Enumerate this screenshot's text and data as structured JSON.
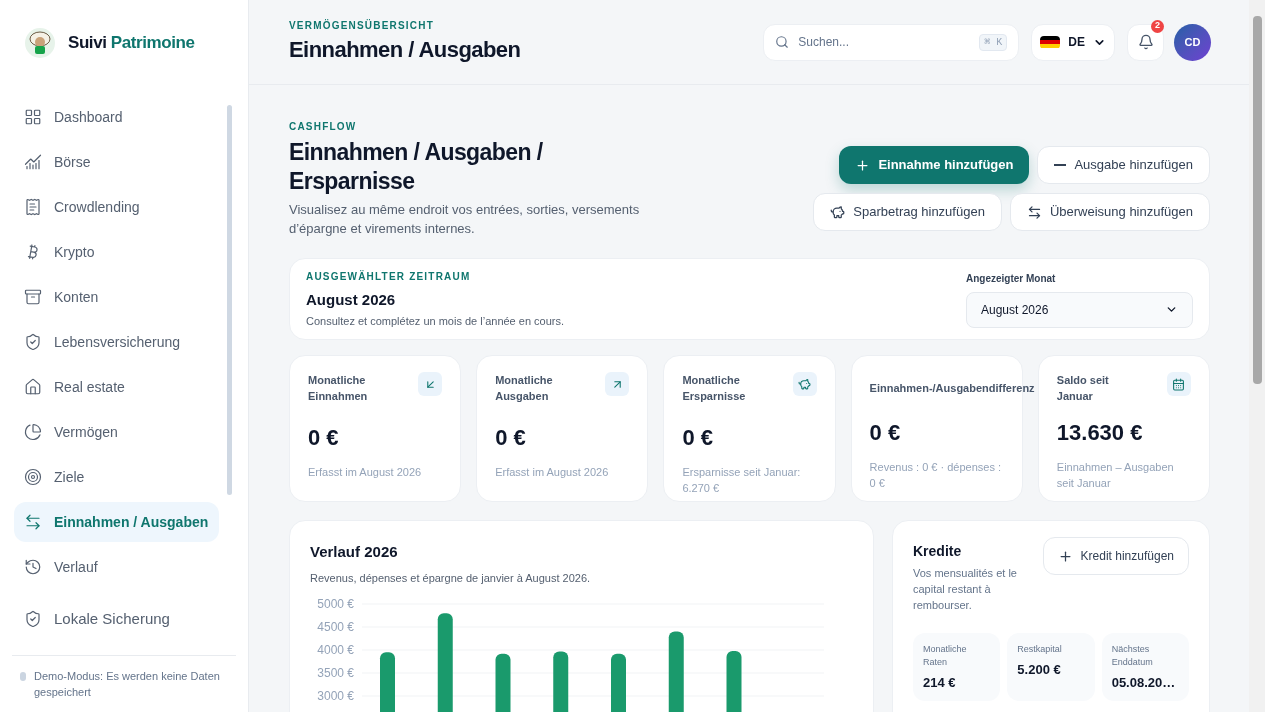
{
  "brand": {
    "first": "Suivi",
    "second": "Patrimoine"
  },
  "sidebar": {
    "items": [
      {
        "label": "Dashboard",
        "selected": false
      },
      {
        "label": "Börse",
        "selected": false
      },
      {
        "label": "Crowdlending",
        "selected": false
      },
      {
        "label": "Krypto",
        "selected": false
      },
      {
        "label": "Konten",
        "selected": false
      },
      {
        "label": "Lebensversicherung",
        "selected": false
      },
      {
        "label": "Real estate",
        "selected": false
      },
      {
        "label": "Vermögen",
        "selected": false
      },
      {
        "label": "Ziele",
        "selected": false
      },
      {
        "label": "Einnahmen / Ausgaben",
        "selected": true
      },
      {
        "label": "Verlauf",
        "selected": false
      }
    ],
    "footer_item": {
      "label": "Lokale Sicherung"
    },
    "demo_note": "Demo-Modus: Es werden keine Daten gespeichert"
  },
  "header": {
    "eyebrow": "VERMÖGENSÜBERSICHT",
    "title": "Einnahmen / Ausgaben",
    "search": {
      "placeholder": "Suchen...",
      "shortcut": [
        "⌘",
        "K"
      ]
    },
    "language": "DE",
    "notifications": "2",
    "avatar": "CD"
  },
  "hero": {
    "eyebrow": "CASHFLOW",
    "title": "Einnahmen / Ausgaben / Ersparnisse",
    "subtitle": "Visualisez au même endroit vos entrées, sorties, versements d’épargne et virements internes.",
    "actions": [
      {
        "label": "Einnahme hinzufügen",
        "kind": "primary"
      },
      {
        "label": "Ausgabe hinzufügen",
        "kind": "minus"
      },
      {
        "label": "Sparbetrag hinzufügen",
        "kind": "piggy"
      },
      {
        "label": "Überweisung hinzufügen",
        "kind": "transfer"
      }
    ]
  },
  "period": {
    "eyebrow": "AUSGEWÄHLTER ZEITRAUM",
    "title": "August 2026",
    "subtitle": "Consultez et complétez un mois de l’année en cours.",
    "select_label": "Angezeigter Monat",
    "select_value": "August 2026"
  },
  "stats": [
    {
      "label": "Monatliche Einnahmen",
      "value": "0 €",
      "note": "Erfasst im August 2026",
      "kind": "in"
    },
    {
      "label": "Monatliche Ausgaben",
      "value": "0 €",
      "note": "Erfasst im August 2026",
      "kind": "out"
    },
    {
      "label": "Monatliche Ersparnisse",
      "value": "0 €",
      "note": "Ersparnisse seit Januar: 6.270 €",
      "kind": "piggy"
    },
    {
      "label": "Einnahmen-/Ausgabendifferenz",
      "value": "0 €",
      "note": "Revenus : 0 € · dépenses : 0 €",
      "kind": "none"
    },
    {
      "label": "Saldo seit Januar",
      "value": "13.630 €",
      "note": "Einnahmen – Ausgaben seit Januar",
      "kind": "calendar"
    }
  ],
  "history": {
    "title": "Verlauf 2026",
    "subtitle": "Revenus, dépenses et épargne de janvier à August 2026.",
    "chart_data": {
      "type": "bar",
      "grid": true,
      "ylim": [
        0,
        5000
      ],
      "yticks": [
        {
          "value": 3000,
          "label": "3000 €"
        },
        {
          "value": 3500,
          "label": "3500 €"
        },
        {
          "value": 4000,
          "label": "4000 €"
        },
        {
          "value": 4500,
          "label": "4500 €"
        },
        {
          "value": 5000,
          "label": "5000 €"
        }
      ],
      "series": [
        {
          "color": "#1a9a6c",
          "values": [
            3950,
            4800,
            3920,
            3970,
            3920,
            4400,
            3980,
            null
          ]
        }
      ]
    }
  },
  "credits": {
    "title": "Kredite",
    "subtitle": "Vos mensualités et le capital restant à rembourser.",
    "add": "Kredit hinzufügen",
    "metrics": [
      {
        "label": "Monatliche Raten",
        "value": "214 €"
      },
      {
        "label": "Restkapital",
        "value": "5.200 €"
      },
      {
        "label": "Nächstes Enddatum",
        "value": "05.08.20…"
      }
    ]
  }
}
